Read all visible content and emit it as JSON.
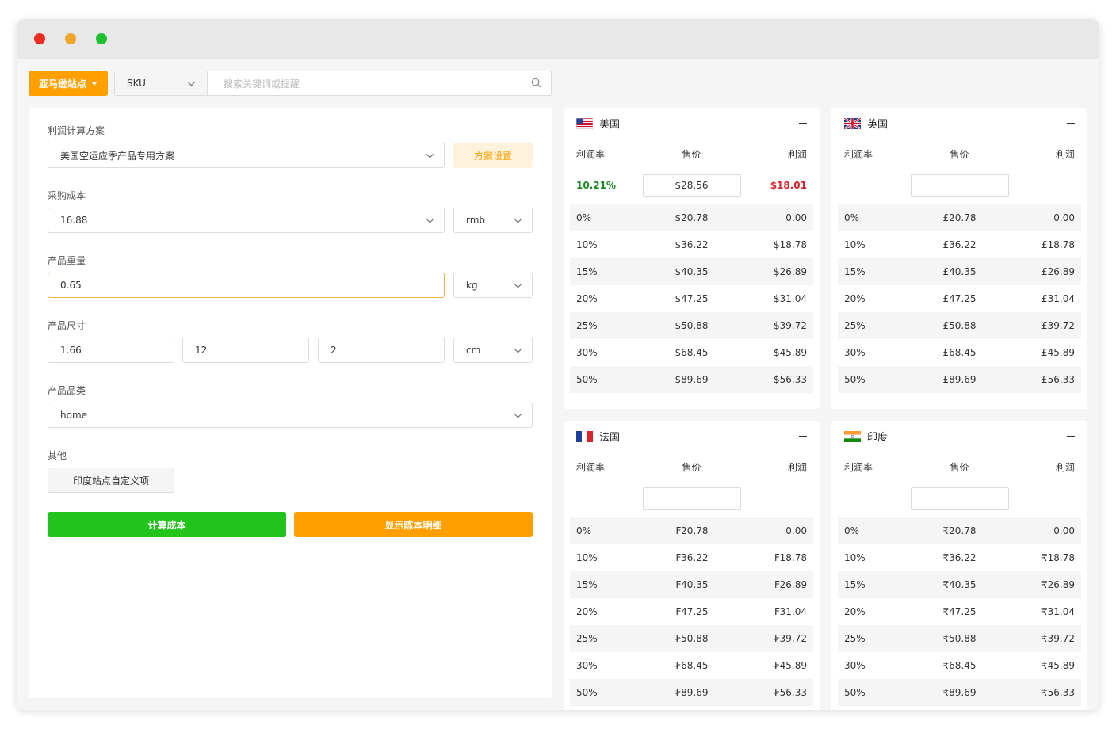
{
  "window": {
    "controls": [
      {
        "name": "close-dot",
        "color": "#ee2b22"
      },
      {
        "name": "minimize-dot",
        "color": "#eea62b"
      },
      {
        "name": "maximize-dot",
        "color": "#21c031"
      }
    ]
  },
  "toolbar": {
    "site_button": "亚马逊站点",
    "sku_select": "SKU",
    "search_placeholder": "搜索关键词或提醒"
  },
  "form": {
    "scheme_label": "利润计算方案",
    "scheme_value": "美国空运应季产品专用方案",
    "scheme_button": "方案设置",
    "cost_label": "采购成本",
    "cost_value": "16.88",
    "cost_unit": "rmb",
    "weight_label": "产品重量",
    "weight_value": "0.65",
    "weight_unit": "kg",
    "size_label": "产品尺寸",
    "size_l": "1.66",
    "size_w": "12",
    "size_h": "2",
    "size_unit": "cm",
    "category_label": "产品品类",
    "category_value": "home",
    "other_label": "其他",
    "india_button": "印度站点自定义项",
    "calc_button": "计算成本",
    "detail_button": "显示陈本明细"
  },
  "colors": {
    "accent": "#ff9f00",
    "green": "#21c41a",
    "margin_green": "#1b8a24",
    "profit_red": "#d8232a"
  },
  "table_headers": {
    "rate": "利润率",
    "price": "售价",
    "profit": "利润"
  },
  "markets": [
    {
      "name": "美国",
      "flag": "us-flag-icon",
      "calc": {
        "rate": "10.21%",
        "price": "$28.56",
        "profit": "$18.01"
      },
      "rows": [
        {
          "rate": "0%",
          "price": "$20.78",
          "profit": "0.00"
        },
        {
          "rate": "10%",
          "price": "$36.22",
          "profit": "$18.78"
        },
        {
          "rate": "15%",
          "price": "$40.35",
          "profit": "$26.89"
        },
        {
          "rate": "20%",
          "price": "$47.25",
          "profit": "$31.04"
        },
        {
          "rate": "25%",
          "price": "$50.88",
          "profit": "$39.72"
        },
        {
          "rate": "30%",
          "price": "$68.45",
          "profit": "$45.89"
        },
        {
          "rate": "50%",
          "price": "$89.69",
          "profit": "$56.33"
        }
      ]
    },
    {
      "name": "英国",
      "flag": "uk-flag-icon",
      "calc": {
        "rate": "",
        "price": "",
        "profit": ""
      },
      "rows": [
        {
          "rate": "0%",
          "price": "£20.78",
          "profit": "0.00"
        },
        {
          "rate": "10%",
          "price": "£36.22",
          "profit": "£18.78"
        },
        {
          "rate": "15%",
          "price": "£40.35",
          "profit": "£26.89"
        },
        {
          "rate": "20%",
          "price": "£47.25",
          "profit": "£31.04"
        },
        {
          "rate": "25%",
          "price": "£50.88",
          "profit": "£39.72"
        },
        {
          "rate": "30%",
          "price": "£68.45",
          "profit": "£45.89"
        },
        {
          "rate": "50%",
          "price": "£89.69",
          "profit": "£56.33"
        }
      ]
    },
    {
      "name": "法国",
      "flag": "fr-flag-icon",
      "calc": {
        "rate": "",
        "price": "",
        "profit": ""
      },
      "rows": [
        {
          "rate": "0%",
          "price": "₣20.78",
          "profit": "0.00"
        },
        {
          "rate": "10%",
          "price": "₣36.22",
          "profit": "₣18.78"
        },
        {
          "rate": "15%",
          "price": "₣40.35",
          "profit": "₣26.89"
        },
        {
          "rate": "20%",
          "price": "₣47.25",
          "profit": "₣31.04"
        },
        {
          "rate": "25%",
          "price": "₣50.88",
          "profit": "₣39.72"
        },
        {
          "rate": "30%",
          "price": "₣68.45",
          "profit": "₣45.89"
        },
        {
          "rate": "50%",
          "price": "₣89.69",
          "profit": "₣56.33"
        }
      ]
    },
    {
      "name": "印度",
      "flag": "in-flag-icon",
      "calc": {
        "rate": "",
        "price": "",
        "profit": ""
      },
      "rows": [
        {
          "rate": "0%",
          "price": "₹20.78",
          "profit": "0.00"
        },
        {
          "rate": "10%",
          "price": "₹36.22",
          "profit": "₹18.78"
        },
        {
          "rate": "15%",
          "price": "₹40.35",
          "profit": "₹26.89"
        },
        {
          "rate": "20%",
          "price": "₹47.25",
          "profit": "₹31.04"
        },
        {
          "rate": "25%",
          "price": "₹50.88",
          "profit": "₹39.72"
        },
        {
          "rate": "30%",
          "price": "₹68.45",
          "profit": "₹45.89"
        },
        {
          "rate": "50%",
          "price": "₹89.69",
          "profit": "₹56.33"
        }
      ]
    }
  ]
}
